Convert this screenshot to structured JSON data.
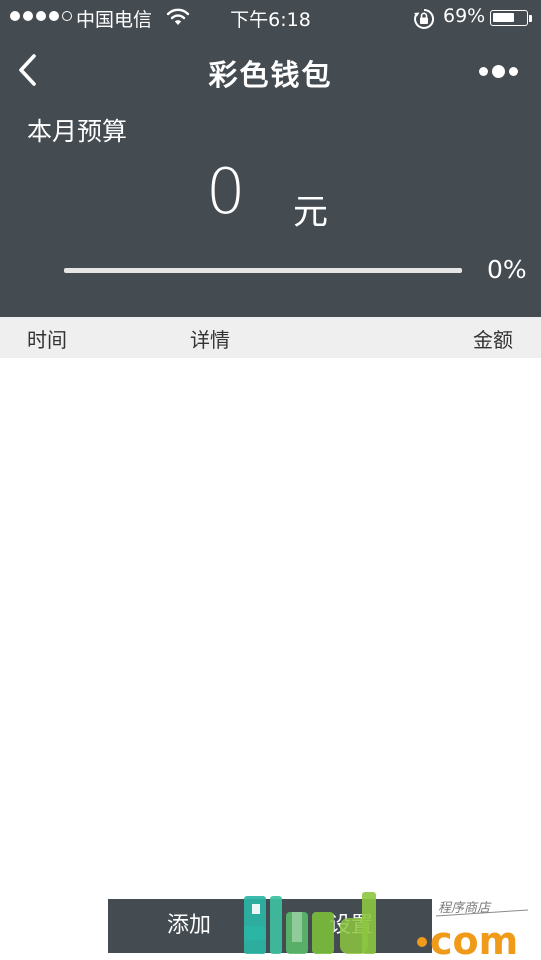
{
  "status_bar": {
    "carrier": "中国电信",
    "time": "下午6:18",
    "battery_percent_text": "69%",
    "battery_level": 0.69,
    "signal_bars": 4,
    "icons": [
      "signal-dots-icon",
      "wifi-icon",
      "rotation-lock-icon",
      "battery-icon"
    ]
  },
  "nav": {
    "title": "彩色钱包",
    "back_icon": "chevron-left-icon",
    "more_icon": "more-dots-icon"
  },
  "budget": {
    "label": "本月预算",
    "amount": "0",
    "unit": "元",
    "percent_text": "0%",
    "progress": 0
  },
  "table": {
    "columns": [
      "时间",
      "详情",
      "金额"
    ],
    "rows": []
  },
  "actions": {
    "add_label": "添加",
    "settings_label": "设置"
  },
  "watermark": {
    "brand": "91ud.com",
    "tagline": "程序商店"
  },
  "colors": {
    "header_bg": "#444b51",
    "table_head_bg": "#efefef",
    "watermark_teal": "#2bb5a5",
    "watermark_green": "#7bbf3a",
    "watermark_orange": "#f09a1a"
  }
}
